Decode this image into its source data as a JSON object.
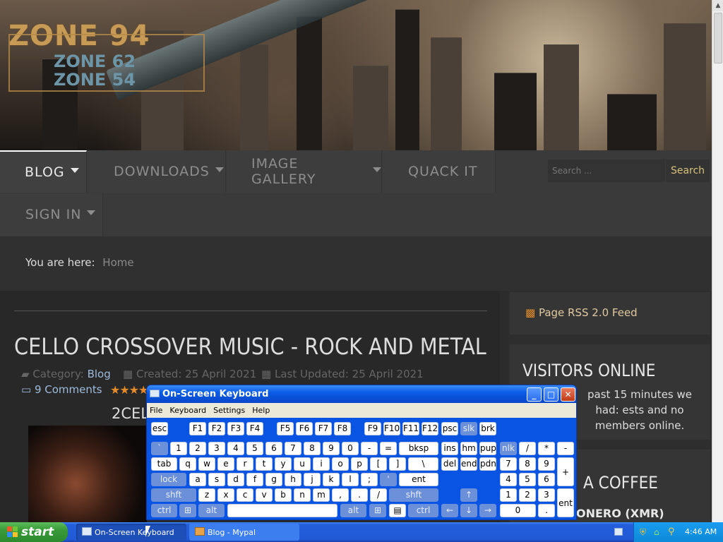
{
  "logo": {
    "line1": "ZONE 94",
    "line2": "ZONE 62",
    "line3": "ZONE 54"
  },
  "nav": {
    "items": [
      {
        "label": "BLOG",
        "dropdown": true,
        "active": true
      },
      {
        "label": "DOWNLOADS",
        "dropdown": true
      },
      {
        "label": "IMAGE GALLERY",
        "dropdown": true
      },
      {
        "label": "QUACK IT",
        "dropdown": false
      },
      {
        "label": "SIGN IN",
        "dropdown": true
      }
    ],
    "search_placeholder": "Search ...",
    "search_button": "Search"
  },
  "breadcrumb": {
    "prefix": "You are here:",
    "home": "Home"
  },
  "article": {
    "title": "CELLO CROSSOVER MUSIC - ROCK AND METAL",
    "category_label": "Category:",
    "category": "Blog",
    "created": "Created: 25 April 2021",
    "updated": "Last Updated: 25 April 2021",
    "comments": "9 Comments",
    "stars": "★★★★",
    "subtitle": "2CELL"
  },
  "sidebar": {
    "rss": "Page RSS 2.0 Feed",
    "visitors_title": "VISITORS ONLINE",
    "visitors_text": "past 15 minutes we had: ests and no members online.",
    "coffee_title": "A COFFEE",
    "monero": "ONERO (XMR)"
  },
  "osk": {
    "title": "On-Screen Keyboard",
    "menu": [
      "File",
      "Keyboard",
      "Settings",
      "Help"
    ],
    "window_buttons": {
      "minimize": "_",
      "maximize": "□",
      "close": "✕"
    }
  },
  "taskbar": {
    "start": "start",
    "tasks": [
      "On-Screen Keyboard",
      "Blog - Mypal"
    ],
    "clock": "4:46 AM"
  },
  "colors": {
    "accent_gold": "#d8c27a",
    "link_blue": "#9dbbdc",
    "xp_blue": "#0a54e3",
    "start_green": "#379b37"
  }
}
